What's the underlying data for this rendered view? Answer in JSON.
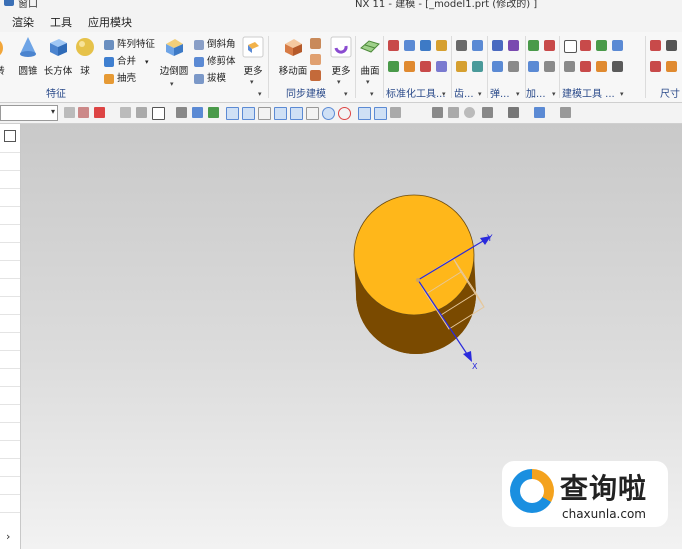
{
  "titlebar": {
    "app_name": "窗口",
    "window_title": "NX 11 - 建模 - [_model1.prt  (修改的) ]"
  },
  "menubar": {
    "items": [
      "渲染",
      "工具",
      "应用模块"
    ]
  },
  "ribbon": {
    "feature_group": {
      "label": "特征",
      "partial_btn": "转",
      "cone": "圆锥",
      "block": "长方体",
      "sphere": "球",
      "pattern_feature": "阵列特征",
      "unite": "合并",
      "shell": "抽壳",
      "edge_blend": "边倒圆",
      "chamfer": "倒斜角",
      "trim_body": "修剪体",
      "draft": "拔模",
      "more": "更多"
    },
    "sync_group": {
      "label": "同步建模",
      "move_face": "移动面",
      "more": "更多"
    },
    "curve_group": {
      "surface": "曲面"
    },
    "group_labels": {
      "standard": "标准化工具...",
      "gear": "齿...",
      "spring": "弹...",
      "machining": "加...",
      "modeling_tools": "建模工具 ...",
      "dimension": "尺寸"
    }
  },
  "selbar": {
    "filter_value": ""
  },
  "navigator": {
    "expand_glyph": "›"
  },
  "model": {
    "body_color_top": "#ffb71a",
    "body_color_side": "#7a4a00",
    "axis_color": "#2a2adc",
    "csys_color": "#e6c79a",
    "y_label": "Y",
    "x_label": "X"
  },
  "watermark": {
    "chinese": "查询啦",
    "url": "chaxunla.com"
  }
}
